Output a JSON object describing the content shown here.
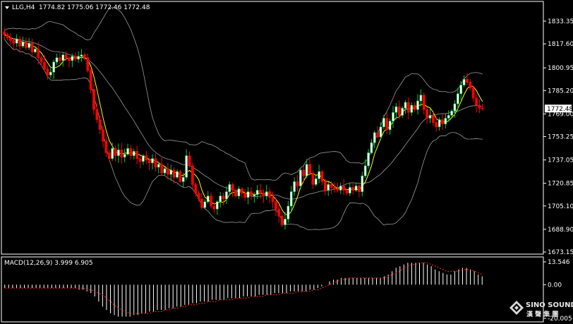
{
  "header": {
    "symbol_label": "LLG,H4",
    "ohlc_text": "1774.82 1775.06 1772.46 1772.48"
  },
  "price_axis": {
    "ticks": [
      "1833.35",
      "1817.60",
      "1800.95",
      "1785.20",
      "1769.00",
      "1753.25",
      "1737.05",
      "1720.85",
      "1705.10",
      "1688.90",
      "1673.15"
    ],
    "current_price_label": "1772.48",
    "current_price": 1772.48
  },
  "macd": {
    "label": "MACD(12,26,9) 3.999 6.905",
    "ticks": [
      "13.546",
      "0.00",
      "-20.005"
    ]
  },
  "logo": {
    "name": "SINO SOUND",
    "chinese": "漢 聲 集 團"
  },
  "colors": {
    "background": "#000000",
    "bull": "#00cc44",
    "bear": "#ff0000",
    "bull_fill": "#ffffff",
    "bear_fill": "#ff0000",
    "ma": "#ffff00",
    "bands": "#9a9a9a",
    "macd_hist": "#ffffff",
    "macd_signal": "#ff2020",
    "grid_frame": "#ffffff"
  },
  "chart_data": [
    {
      "type": "candlestick",
      "title": "LLG,H4",
      "ylim": [
        1673.15,
        1833.35
      ],
      "closes": [
        1824,
        1822,
        1820,
        1818,
        1821,
        1816,
        1819,
        1815,
        1818,
        1812,
        1814,
        1808,
        1805,
        1800,
        1796,
        1798,
        1805,
        1808,
        1806,
        1810,
        1808,
        1806,
        1809,
        1807,
        1809,
        1810,
        1808,
        1799,
        1786,
        1772,
        1765,
        1758,
        1750,
        1742,
        1738,
        1745,
        1740,
        1744,
        1739,
        1741,
        1745,
        1740,
        1743,
        1738,
        1736,
        1740,
        1737,
        1735,
        1738,
        1732,
        1734,
        1728,
        1731,
        1727,
        1730,
        1725,
        1729,
        1722,
        1725,
        1740,
        1733,
        1720,
        1714,
        1710,
        1704,
        1708,
        1712,
        1705,
        1703,
        1708,
        1712,
        1710,
        1715,
        1720,
        1716,
        1712,
        1717,
        1714,
        1711,
        1715,
        1712,
        1713,
        1716,
        1714,
        1712,
        1715,
        1711,
        1708,
        1703,
        1698,
        1692,
        1696,
        1705,
        1715,
        1722,
        1719,
        1730,
        1726,
        1734,
        1728,
        1720,
        1724,
        1729,
        1722,
        1716,
        1720,
        1718,
        1717,
        1716,
        1719,
        1716,
        1714,
        1718,
        1716,
        1719,
        1715,
        1726,
        1733,
        1742,
        1749,
        1756,
        1753,
        1760,
        1766,
        1758,
        1764,
        1770,
        1774,
        1768,
        1773,
        1777,
        1770,
        1775,
        1772,
        1778,
        1782,
        1772,
        1766,
        1768,
        1763,
        1760,
        1765,
        1762,
        1766,
        1768,
        1771,
        1776,
        1783,
        1789,
        1793,
        1791,
        1787,
        1780,
        1775,
        1773,
        1772.48
      ]
    },
    {
      "type": "bar",
      "title": "MACD(12,26,9)",
      "ylim": [
        -20.005,
        13.546
      ],
      "histogram": [
        -2,
        -2,
        -2,
        -2,
        -2,
        -2,
        -2,
        -2,
        -2,
        -2,
        -2,
        -2,
        -2,
        -2,
        -2,
        -2,
        -2,
        -2,
        -2,
        -3,
        -3,
        -4,
        -5,
        -7,
        -10,
        -13,
        -15,
        -17,
        -18,
        -19,
        -19,
        -19,
        -19,
        -18,
        -18,
        -17,
        -17,
        -16,
        -16,
        -15,
        -15,
        -15,
        -14,
        -14,
        -13,
        -13,
        -12,
        -12,
        -11,
        -11,
        -10,
        -10,
        -10,
        -9,
        -9,
        -9,
        -9,
        -8,
        -8,
        -8,
        -8,
        -7,
        -7,
        -7,
        -7,
        -6,
        -6,
        -6,
        -6,
        -5,
        -5,
        -5,
        -5,
        -4,
        -4,
        -4,
        -4,
        -4,
        -3,
        -3,
        -2,
        -1,
        0,
        2,
        3,
        3,
        4,
        4,
        4,
        4,
        4,
        4,
        4,
        4,
        4,
        4,
        4,
        5,
        6,
        8,
        10,
        11,
        12,
        13,
        13,
        13,
        13,
        13,
        12,
        11,
        9,
        8,
        7,
        6,
        6,
        8,
        9,
        10,
        10,
        9,
        8,
        6,
        5
      ],
      "signal": [
        -2,
        -2,
        -2,
        -2,
        -2,
        -2,
        -2,
        -2,
        -2,
        -2,
        -2,
        -2,
        -2,
        -2,
        -2,
        -2,
        -2,
        -2,
        -2,
        -2,
        -2,
        -3,
        -3,
        -4,
        -5,
        -6,
        -8,
        -10,
        -12,
        -14,
        -15,
        -16,
        -17,
        -17,
        -17,
        -17,
        -17,
        -17,
        -16,
        -16,
        -16,
        -15,
        -15,
        -14,
        -14,
        -13,
        -13,
        -12,
        -12,
        -12,
        -11,
        -11,
        -10,
        -10,
        -10,
        -9,
        -9,
        -9,
        -9,
        -8,
        -8,
        -8,
        -8,
        -7,
        -7,
        -7,
        -7,
        -6,
        -6,
        -6,
        -6,
        -5,
        -5,
        -5,
        -5,
        -4,
        -4,
        -4,
        -4,
        -3,
        -3,
        -2,
        -1,
        0,
        1,
        2,
        3,
        3,
        4,
        4,
        4,
        4,
        4,
        4,
        4,
        4,
        4,
        4,
        5,
        6,
        7,
        8,
        10,
        11,
        12,
        12,
        13,
        13,
        13,
        12,
        11,
        10,
        9,
        8,
        8,
        8,
        8,
        9,
        9,
        9,
        8,
        7,
        6
      ]
    }
  ]
}
